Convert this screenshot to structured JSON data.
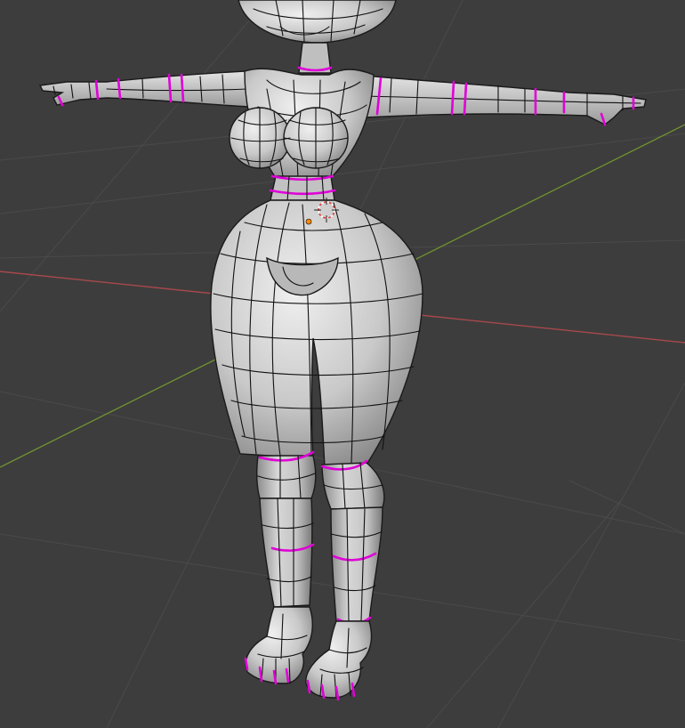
{
  "viewport": {
    "background": "#3d3d3d",
    "grid_color": "#4a4a4a",
    "x_axis_color": "#a8484c",
    "y_axis_color": "#6f8f35"
  },
  "mesh": {
    "base_color": "#c8c8c8",
    "shade_color": "#7d7d7d",
    "highlight_color": "#ececec",
    "wire_color": "#111111",
    "seam_color": "#e000d8"
  },
  "origin": {
    "color": "#ff8a00"
  },
  "cursor": {
    "ring_a": "#e04040",
    "ring_b": "#ffffff"
  },
  "icons": {
    "cursor": "3d-cursor-icon",
    "origin": "object-origin-icon"
  }
}
